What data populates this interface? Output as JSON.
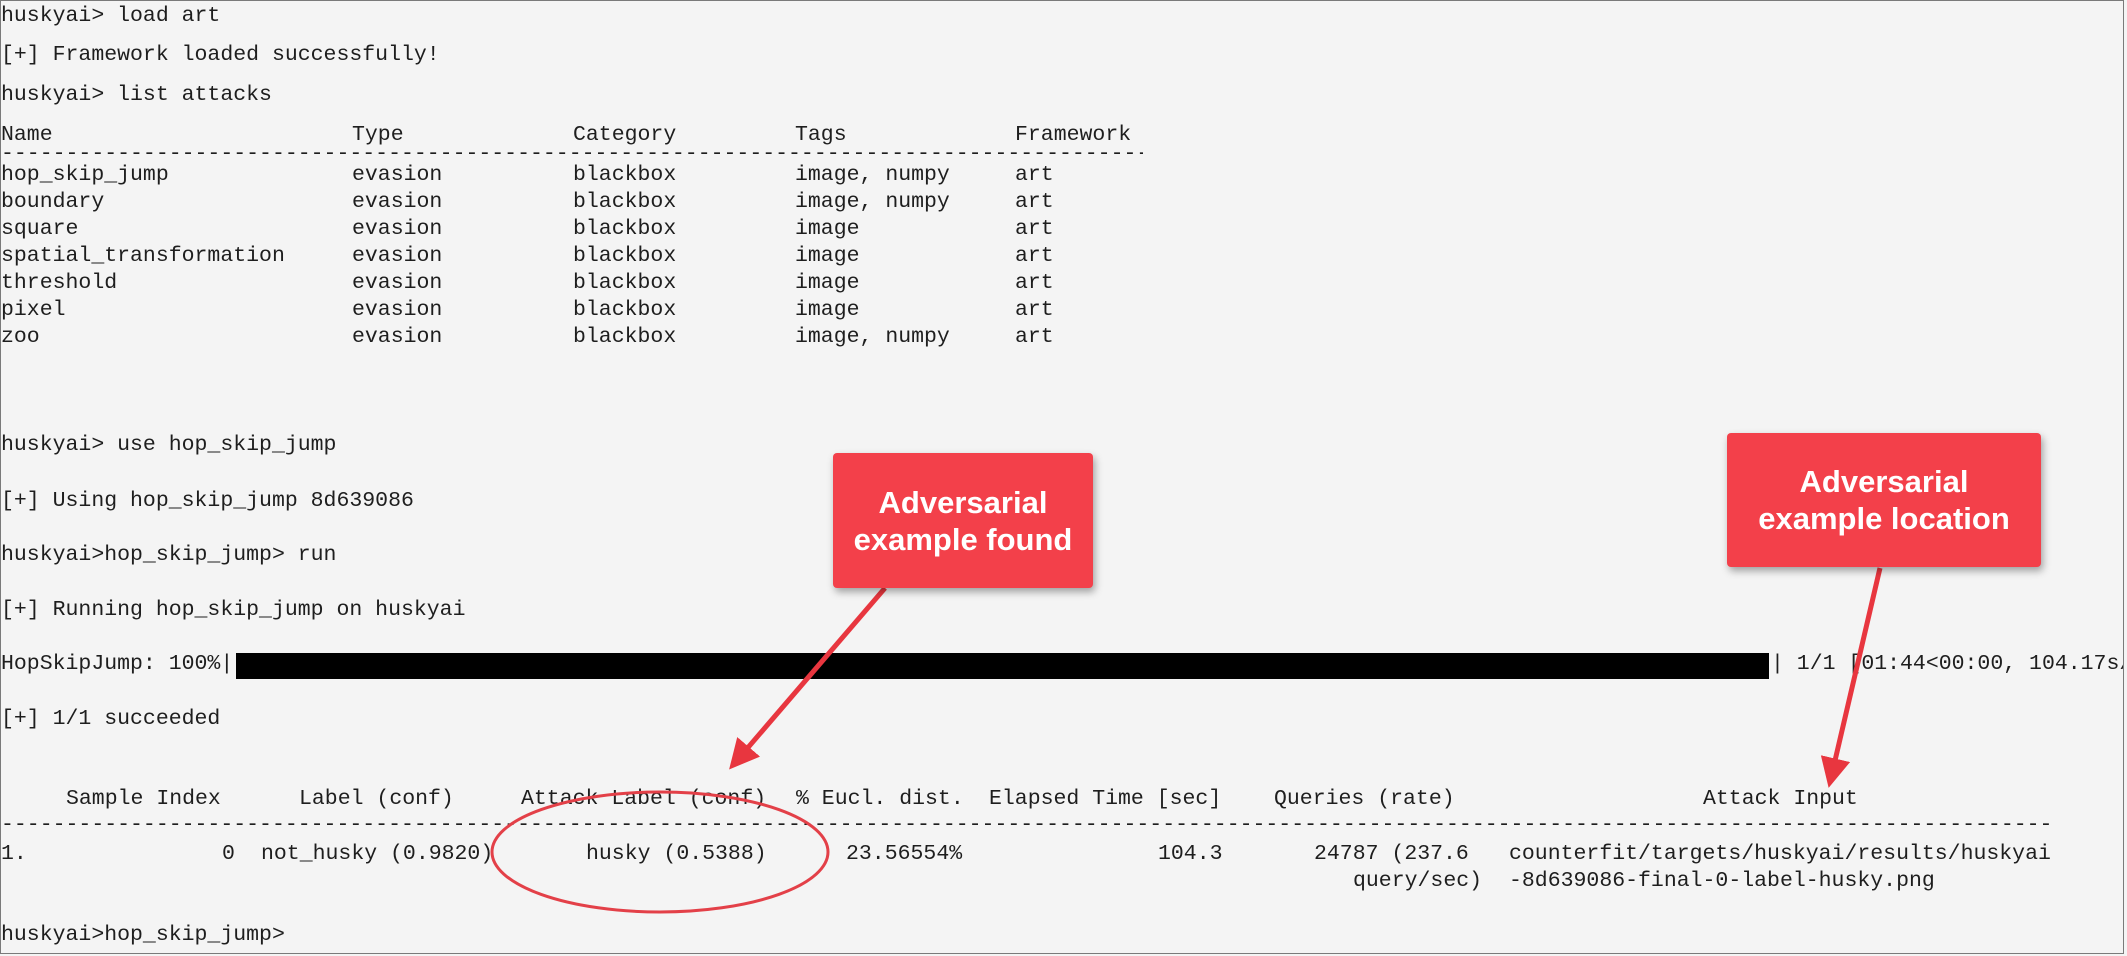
{
  "terminal": {
    "line1": "huskyai> load art",
    "line2": "[+] Framework loaded successfully!",
    "line3": "huskyai> list attacks",
    "attack_headers": [
      "Name",
      "Type",
      "Category",
      "Tags",
      "Framework"
    ],
    "attacks": [
      {
        "name": "hop_skip_jump",
        "type": "evasion",
        "category": "blackbox",
        "tags": "image, numpy",
        "framework": "art"
      },
      {
        "name": "boundary",
        "type": "evasion",
        "category": "blackbox",
        "tags": "image, numpy",
        "framework": "art"
      },
      {
        "name": "square",
        "type": "evasion",
        "category": "blackbox",
        "tags": "image",
        "framework": "art"
      },
      {
        "name": "spatial_transformation",
        "type": "evasion",
        "category": "blackbox",
        "tags": "image",
        "framework": "art"
      },
      {
        "name": "threshold",
        "type": "evasion",
        "category": "blackbox",
        "tags": "image",
        "framework": "art"
      },
      {
        "name": "pixel",
        "type": "evasion",
        "category": "blackbox",
        "tags": "image",
        "framework": "art"
      },
      {
        "name": "zoo",
        "type": "evasion",
        "category": "blackbox",
        "tags": "image, numpy",
        "framework": "art"
      }
    ],
    "line4": "huskyai> use hop_skip_jump",
    "line5": "[+] Using hop_skip_jump 8d639086",
    "line6": "huskyai>hop_skip_jump> run",
    "line7": "[+] Running hop_skip_jump on huskyai",
    "progress": {
      "label": "HopSkipJump: 100%|",
      "percent": 100,
      "suffix": "| 1/1 [01:44<00:00, 104.17s/"
    },
    "line8": "[+] 1/1 succeeded",
    "result_headers": {
      "sample_index": "Sample Index",
      "label": "Label (conf)",
      "attack_label": "Attack Label (conf)",
      "eucl": "% Eucl. dist.",
      "elapsed": "Elapsed Time [sec]",
      "queries": "Queries (rate)",
      "attack_input": "Attack Input"
    },
    "result_row": {
      "num": "1.",
      "sample_index": "0",
      "label": "not_husky (0.9820)",
      "attack_label": "husky (0.5388)",
      "eucl": "23.56554%",
      "elapsed": "104.3",
      "queries_line1": "24787 (237.6",
      "queries_line2": "query/sec)",
      "attack_input_line1": "counterfit/targets/huskyai/results/huskyai",
      "attack_input_line2": "-8d639086-final-0-label-husky.png"
    },
    "line9": "huskyai>hop_skip_jump>"
  },
  "callouts": {
    "found": "Adversarial\nexample found",
    "location": "Adversarial\nexample location",
    "color": "#f3404a"
  }
}
